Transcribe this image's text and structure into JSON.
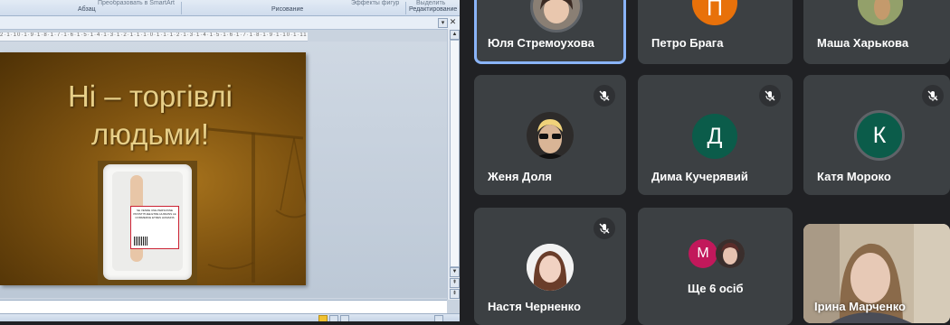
{
  "ppt": {
    "ribbon": {
      "groups": [
        "Абзац",
        "Рисование",
        "Редактирование"
      ],
      "commands": [
        "Преобразовать в SmartArt",
        "Эффекты фигур",
        "Выделить"
      ]
    },
    "slide": {
      "title_line1": "Ні – торгівлі",
      "title_line2": "людьми!",
      "label_text": "SE VENDE UNE PERSONNE PROSTITUEE ETRE HUMAINS LE COMMERCE ETRES HUMAINS"
    },
    "ruler_text": "2·1·10·1·9·1·8·1·7·1·6·1·5·1·4·1·3·1·2·1·1·1·0·1·1·1·2·1·3·1·4·1·5·1·6·1·7·1·8·1·9·1·10·1·11·1·12"
  },
  "meeting": {
    "participants": [
      {
        "name": "Юля Стремоухова",
        "avatar_type": "photo",
        "muted": false,
        "active": true
      },
      {
        "name": "Петро Брага",
        "avatar_type": "letter",
        "letter": "П",
        "color": "#e8710a",
        "muted": false
      },
      {
        "name": "Маша Харькова",
        "avatar_type": "photo",
        "muted": false
      },
      {
        "name": "Женя Доля",
        "avatar_type": "photo",
        "muted": true
      },
      {
        "name": "Дима Кучерявий",
        "avatar_type": "letter",
        "letter": "Д",
        "color": "#0b5c4a",
        "muted": true
      },
      {
        "name": "Катя Мороко",
        "avatar_type": "letter",
        "letter": "К",
        "color": "#0b5c4a",
        "muted": true
      },
      {
        "name": "Настя Черненко",
        "avatar_type": "photo",
        "muted": true
      },
      {
        "name": "Ірина Марченко",
        "avatar_type": "video",
        "muted": false
      }
    ],
    "more": {
      "label": "Ще 6 осіб",
      "mini_letter": "М",
      "mini_color": "#c2185b"
    },
    "colors": {
      "background": "#202124",
      "tile": "#3c4043",
      "active_border": "#8ab4f8"
    }
  }
}
